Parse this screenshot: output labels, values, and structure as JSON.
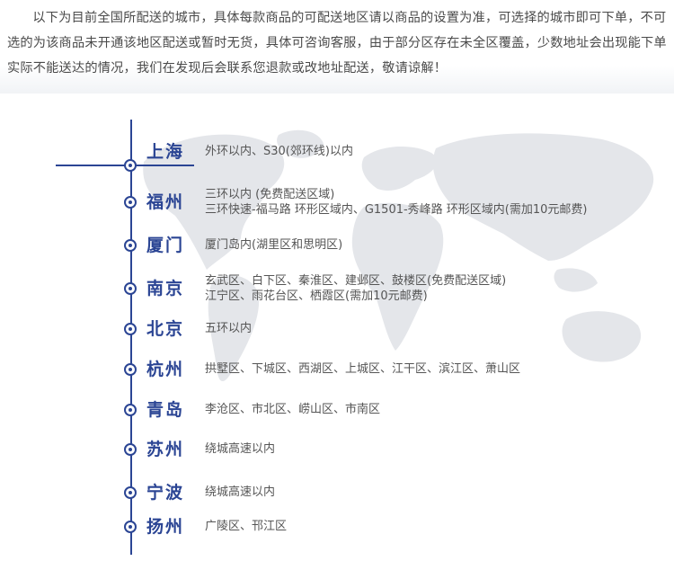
{
  "intro": {
    "text": "以下为目前全国所配送的城市，具体每款商品的可配送地区请以商品的设置为准，可选择的城市即可下单，不可选的为该商品未开通该地区配送或暂时无货，具体可咨询客服，由于部分区存在未全区覆盖，少数地址会出现能下单实际不能送达的情况，我们在发现后会联系您退款或改地址配送，敬请谅解！"
  },
  "colors": {
    "accent": "#2b4594",
    "text": "#555555",
    "map": "#e4e6ea"
  },
  "cities": [
    {
      "name": "上海",
      "lines": [
        "外环以内、S30(郊环线)以内"
      ]
    },
    {
      "name": "福州",
      "lines": [
        "三环以内 (免费配送区域)",
        "三环快速-福马路 环形区域内、G1501-秀峰路 环形区域内(需加10元邮费)"
      ]
    },
    {
      "name": "厦门",
      "lines": [
        "厦门岛内(湖里区和思明区)"
      ]
    },
    {
      "name": "南京",
      "lines": [
        "玄武区、白下区、秦淮区、建邺区、鼓楼区(免费配送区域)",
        "江宁区、雨花台区、栖霞区(需加10元邮费)"
      ]
    },
    {
      "name": "北京",
      "lines": [
        "五环以内"
      ]
    },
    {
      "name": "杭州",
      "lines": [
        "拱墅区、下城区、西湖区、上城区、江干区、滨江区、萧山区"
      ]
    },
    {
      "name": "青岛",
      "lines": [
        "李沧区、市北区、崂山区、市南区"
      ]
    },
    {
      "name": "苏州",
      "lines": [
        "绕城高速以内"
      ]
    },
    {
      "name": "宁波",
      "lines": [
        "绕城高速以内"
      ]
    },
    {
      "name": "扬州",
      "lines": [
        "广陵区、邗江区"
      ]
    }
  ]
}
